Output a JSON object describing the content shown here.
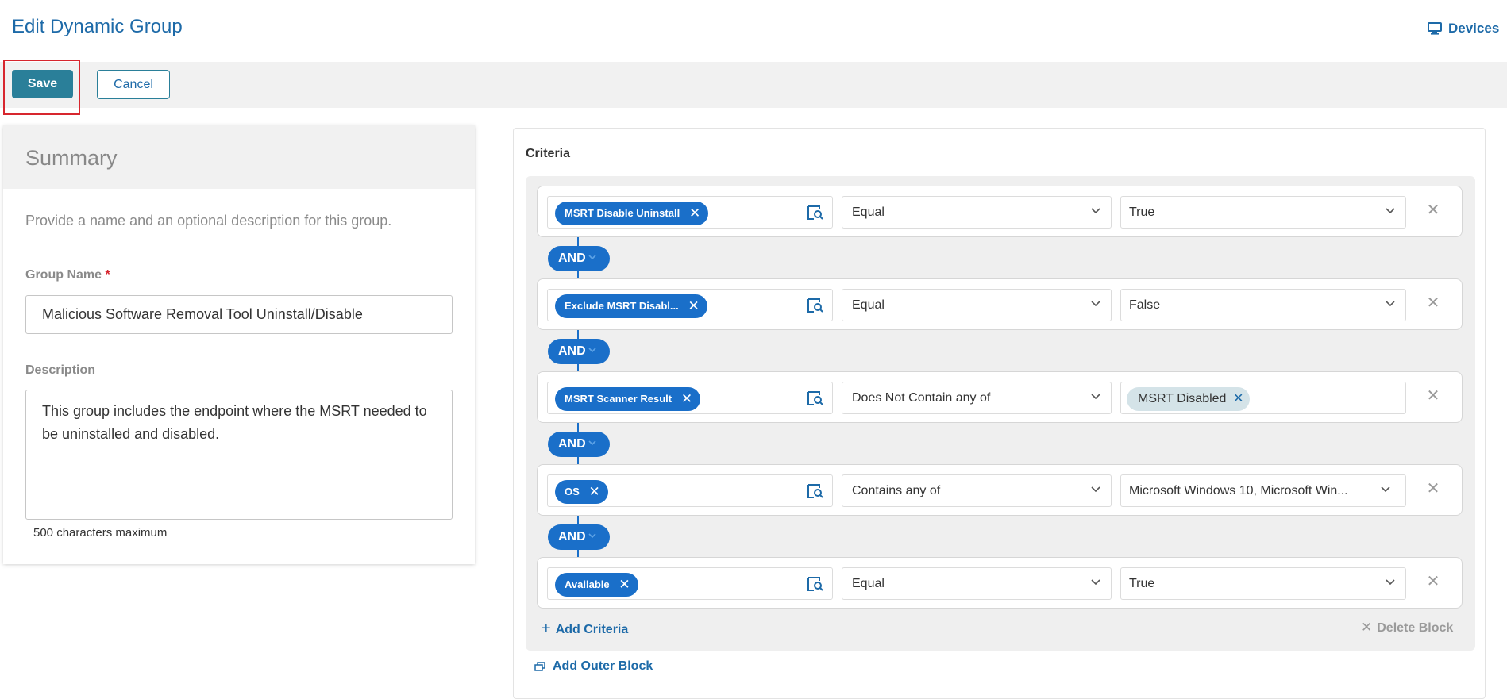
{
  "header": {
    "title": "Edit Dynamic Group",
    "devices_link": "Devices"
  },
  "toolbar": {
    "save_label": "Save",
    "cancel_label": "Cancel"
  },
  "summary": {
    "title": "Summary",
    "description": "Provide a name and an optional description for this group.",
    "group_name_label": "Group Name",
    "required_mark": "*",
    "group_name_value": "Malicious Software Removal Tool Uninstall/Disable",
    "description_label": "Description",
    "description_value": "This group includes the endpoint where the MSRT needed to be uninstalled and disabled.",
    "description_hint": "500 characters maximum"
  },
  "criteria": {
    "title": "Criteria",
    "connector": "AND",
    "rows": [
      {
        "field": "MSRT Disable Uninstall",
        "operator": "Equal",
        "value": "True",
        "value_type": "select"
      },
      {
        "field": "Exclude MSRT Disabl...",
        "operator": "Equal",
        "value": "False",
        "value_type": "select"
      },
      {
        "field": "MSRT Scanner Result",
        "operator": "Does Not Contain any of",
        "value": "MSRT Disabled",
        "value_type": "tag"
      },
      {
        "field": "OS",
        "operator": "Contains any of",
        "value": "Microsoft Windows 10, Microsoft Win...",
        "value_type": "select"
      },
      {
        "field": "Available",
        "operator": "Equal",
        "value": "True",
        "value_type": "select"
      }
    ],
    "add_criteria_label": "Add Criteria",
    "delete_block_label": "Delete Block",
    "add_outer_block_label": "Add Outer Block"
  },
  "colors": {
    "brand_blue": "#1d6aa8",
    "pill_blue": "#1a6fc9",
    "save_teal": "#2a7f99",
    "highlight_red": "#d7262e"
  }
}
